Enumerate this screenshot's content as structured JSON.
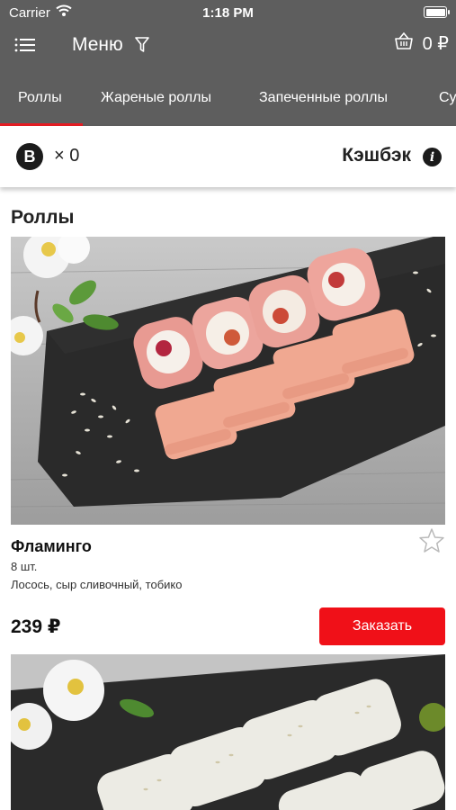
{
  "status_bar": {
    "carrier": "Carrier",
    "time": "1:18 PM"
  },
  "nav": {
    "title": "Меню",
    "cart_total": "0 ₽",
    "icons": [
      "menu-icon",
      "filter-icon",
      "basket-icon"
    ]
  },
  "tabs": [
    {
      "label": "Роллы",
      "active": true
    },
    {
      "label": "Жареные роллы",
      "active": false
    },
    {
      "label": "Запеченные роллы",
      "active": false
    },
    {
      "label": "Су",
      "active": false
    }
  ],
  "bonus": {
    "badge": "B",
    "count": "× 0",
    "cashback_label": "Кэшбэк",
    "info": "i"
  },
  "section": {
    "title": "Роллы"
  },
  "products": [
    {
      "name": "Фламинго",
      "qty": "8 шт.",
      "description": "Лосось, сыр сливочный, тобико",
      "price": "239 ₽",
      "order_label": "Заказать"
    }
  ],
  "colors": {
    "header": "#5e5e5e",
    "accent": "#e61c23",
    "button": "#f01018"
  }
}
